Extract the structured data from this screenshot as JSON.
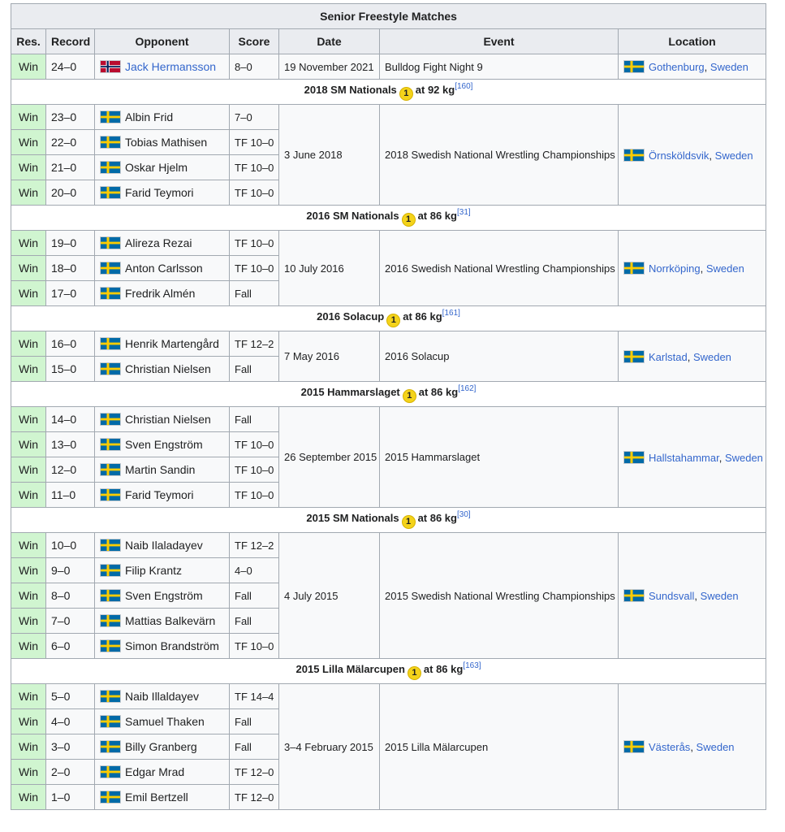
{
  "title": "Senior Freestyle Matches",
  "headers": [
    "Res.",
    "Record",
    "Opponent",
    "Score",
    "Date",
    "Event",
    "Location"
  ],
  "colors": {
    "win": "#d0f5d0",
    "header": "#eaecf0",
    "link": "#3366cc",
    "border": "#a2a9b1",
    "medal": "#f4d31a"
  },
  "first_group": {
    "matches": [
      {
        "res": "Win",
        "record": "24–0",
        "flag": "norway-flag-icon",
        "opponent": "Jack Hermansson",
        "score": "8–0"
      }
    ],
    "date": "19 November 2021",
    "event": "Bulldog Fight Night 9",
    "city": "Gothenburg",
    "country": "Sweden"
  },
  "groups": [
    {
      "name": "2018 SM Nationals",
      "medal": "1",
      "weight": "at 92 kg",
      "ref": "[160]",
      "date": "3 June 2018",
      "event": "2018 Swedish National Wrestling Championships",
      "city": "Örnsköldsvik",
      "country": "Sweden",
      "matches": [
        {
          "res": "Win",
          "record": "23–0",
          "opponent": "Albin Frid",
          "score": "7–0"
        },
        {
          "res": "Win",
          "record": "22–0",
          "opponent": "Tobias Mathisen",
          "score": "TF 10–0"
        },
        {
          "res": "Win",
          "record": "21–0",
          "opponent": "Oskar Hjelm",
          "score": "TF 10–0"
        },
        {
          "res": "Win",
          "record": "20–0",
          "opponent": "Farid Teymori",
          "score": "TF 10–0"
        }
      ]
    },
    {
      "name": "2016 SM Nationals",
      "medal": "1",
      "weight": "at 86 kg",
      "ref": "[31]",
      "date": "10 July 2016",
      "event": "2016 Swedish National Wrestling Championships",
      "city": "Norrköping",
      "country": "Sweden",
      "matches": [
        {
          "res": "Win",
          "record": "19–0",
          "opponent": "Alireza Rezai",
          "score": "TF 10–0"
        },
        {
          "res": "Win",
          "record": "18–0",
          "opponent": "Anton Carlsson",
          "score": "TF 10–0"
        },
        {
          "res": "Win",
          "record": "17–0",
          "opponent": "Fredrik Almén",
          "score": "Fall"
        }
      ]
    },
    {
      "name": "2016 Solacup",
      "medal": "1",
      "weight": "at 86 kg",
      "ref": "[161]",
      "date": "7 May 2016",
      "event": "2016 Solacup",
      "city": "Karlstad",
      "country": "Sweden",
      "matches": [
        {
          "res": "Win",
          "record": "16–0",
          "opponent": "Henrik Martengård",
          "score": "TF 12–2"
        },
        {
          "res": "Win",
          "record": "15–0",
          "opponent": "Christian Nielsen",
          "score": "Fall"
        }
      ]
    },
    {
      "name": "2015 Hammarslaget",
      "medal": "1",
      "weight": "at 86 kg",
      "ref": "[162]",
      "date": "26 September 2015",
      "event": "2015 Hammarslaget",
      "city": "Hallstahammar",
      "country": "Sweden",
      "matches": [
        {
          "res": "Win",
          "record": "14–0",
          "opponent": "Christian Nielsen",
          "score": "Fall"
        },
        {
          "res": "Win",
          "record": "13–0",
          "opponent": "Sven Engström",
          "score": "TF 10–0"
        },
        {
          "res": "Win",
          "record": "12–0",
          "opponent": "Martin Sandin",
          "score": "TF 10–0"
        },
        {
          "res": "Win",
          "record": "11–0",
          "opponent": "Farid Teymori",
          "score": "TF 10–0"
        }
      ]
    },
    {
      "name": "2015 SM Nationals",
      "medal": "1",
      "weight": "at 86 kg",
      "ref": "[30]",
      "date": "4 July 2015",
      "event": "2015 Swedish National Wrestling Championships",
      "city": "Sundsvall",
      "country": "Sweden",
      "matches": [
        {
          "res": "Win",
          "record": "10–0",
          "opponent": "Naib Ilaladayev",
          "score": "TF 12–2"
        },
        {
          "res": "Win",
          "record": "9–0",
          "opponent": "Filip Krantz",
          "score": "4–0"
        },
        {
          "res": "Win",
          "record": "8–0",
          "opponent": "Sven Engström",
          "score": "Fall"
        },
        {
          "res": "Win",
          "record": "7–0",
          "opponent": "Mattias Balkevärn",
          "score": "Fall"
        },
        {
          "res": "Win",
          "record": "6–0",
          "opponent": "Simon Brandström",
          "score": "TF 10–0"
        }
      ]
    },
    {
      "name": "2015 Lilla Mälarcupen",
      "medal": "1",
      "weight": "at 86 kg",
      "ref": "[163]",
      "date": "3–4 February 2015",
      "event": "2015 Lilla Mälarcupen",
      "city": "Västerås",
      "country": "Sweden",
      "matches": [
        {
          "res": "Win",
          "record": "5–0",
          "opponent": "Naib Illaldayev",
          "score": "TF 14–4"
        },
        {
          "res": "Win",
          "record": "4–0",
          "opponent": "Samuel Thaken",
          "score": "Fall"
        },
        {
          "res": "Win",
          "record": "3–0",
          "opponent": "Billy Granberg",
          "score": "Fall"
        },
        {
          "res": "Win",
          "record": "2–0",
          "opponent": "Edgar Mrad",
          "score": "TF 12–0"
        },
        {
          "res": "Win",
          "record": "1–0",
          "opponent": "Emil Bertzell",
          "score": "TF 12–0"
        }
      ]
    }
  ]
}
